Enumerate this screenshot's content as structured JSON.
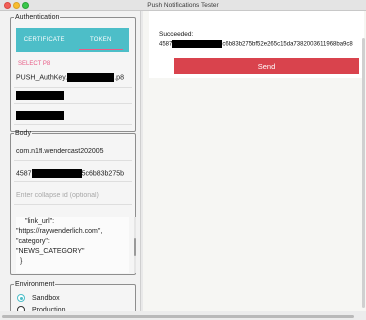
{
  "window": {
    "title": "Push Notifications Tester"
  },
  "authentication": {
    "legend": "Authentication",
    "segments": [
      {
        "label": "CERTIFICATE",
        "active": false
      },
      {
        "label": "TOKEN",
        "active": true
      }
    ],
    "select_p8_label": "SELECT P8",
    "key_file_prefix": "PUSH_AuthKey.",
    "key_file_suffix": ".p8"
  },
  "body": {
    "legend": "Body",
    "bundle_id": "com.n1fl.wendercast202005",
    "device_token_prefix": "4587",
    "device_token_suffix": "5c6b83b275b",
    "collapse_id_placeholder": "Enter collapse id (optional)",
    "payload_lines": [
      "\"link_url\":",
      "\"https://raywenderlich.com\",",
      "\"category\":",
      "\"NEWS_CATEGORY\"",
      "}"
    ]
  },
  "environment": {
    "legend": "Environment",
    "options": [
      {
        "label": "Sandbox",
        "checked": true
      },
      {
        "label": "Production",
        "checked": false
      }
    ]
  },
  "result": {
    "status_label": "Succeeded:",
    "token_prefix": "4587",
    "token_suffix": "c6b83b275bf52e265c15da7382003611968ba9c8"
  },
  "send_button": {
    "label": "Send"
  },
  "colors": {
    "accent": "#4dbec8",
    "highlight": "#e85c86",
    "send": "#d9434d"
  }
}
